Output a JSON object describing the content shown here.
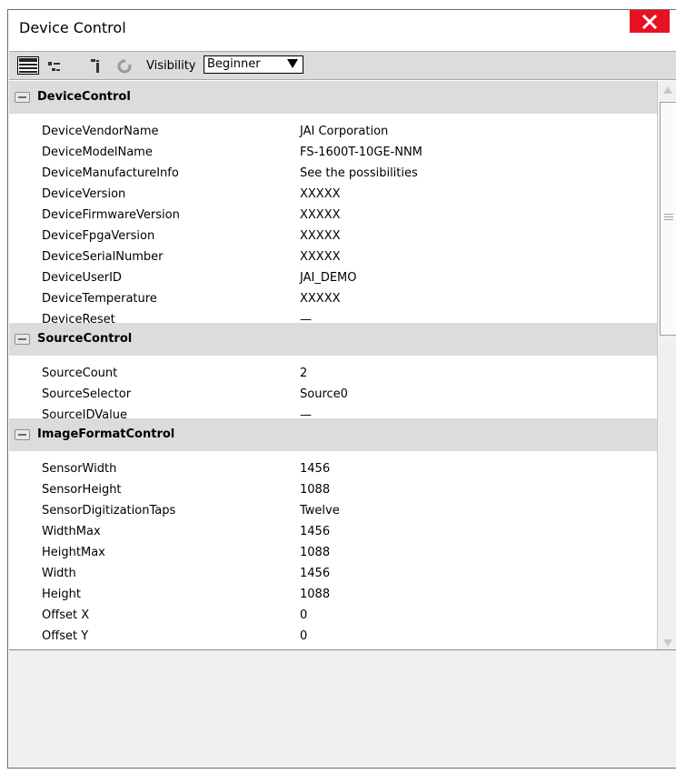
{
  "window": {
    "title": "Device Control"
  },
  "toolbar": {
    "visibility_label": "Visibility",
    "visibility_value": "Beginner"
  },
  "categories": [
    {
      "label": "DeviceControl",
      "rows": [
        {
          "name": "DeviceVendorName",
          "value": "JAI Corporation"
        },
        {
          "name": "DeviceModelName",
          "value": "FS-1600T-10GE-NNM"
        },
        {
          "name": "DeviceManufactureInfo",
          "value": "See the possibilities"
        },
        {
          "name": "DeviceVersion",
          "value": "XXXXX"
        },
        {
          "name": "DeviceFirmwareVersion",
          "value": "XXXXX"
        },
        {
          "name": "DeviceFpgaVersion",
          "value": "XXXXX"
        },
        {
          "name": "DeviceSerialNumber",
          "value": "XXXXX"
        },
        {
          "name": "DeviceUserID",
          "value": "JAI_DEMO"
        },
        {
          "name": "DeviceTemperature",
          "value": "XXXXX"
        },
        {
          "name": "DeviceReset",
          "value": "—"
        }
      ]
    },
    {
      "label": "SourceControl",
      "rows": [
        {
          "name": "SourceCount",
          "value": "2"
        },
        {
          "name": "SourceSelector",
          "value": "Source0"
        },
        {
          "name": "SourceIDValue",
          "value": "—"
        }
      ]
    },
    {
      "label": "ImageFormatControl",
      "rows": [
        {
          "name": "SensorWidth",
          "value": "1456"
        },
        {
          "name": "SensorHeight",
          "value": "1088"
        },
        {
          "name": "SensorDigitizationTaps",
          "value": "Twelve"
        },
        {
          "name": "WidthMax",
          "value": "1456"
        },
        {
          "name": "HeightMax",
          "value": "1088"
        },
        {
          "name": "Width",
          "value": "1456"
        },
        {
          "name": "Height",
          "value": "1088"
        },
        {
          "name": "Offset X",
          "value": "0"
        },
        {
          "name": "Offset Y",
          "value": "0"
        }
      ]
    }
  ],
  "colors": {
    "close": "#e81123",
    "category_bg": "#dcdcdc",
    "toolbar_bg": "#dcdcdc",
    "description_bg": "#f0f0f0"
  }
}
